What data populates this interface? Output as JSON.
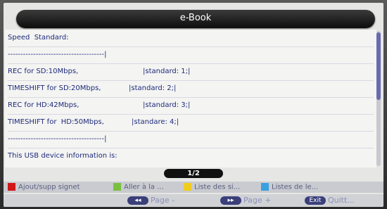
{
  "window": {
    "title": "e-Book"
  },
  "lines": [
    {
      "left": "Speed  Standard:",
      "right": ""
    },
    {
      "left": "--------------------------------------|",
      "right": ""
    },
    {
      "left": "REC for SD:10Mbps,",
      "right": "|standard: 1;|"
    },
    {
      "left": "TIMESHIFT for SD:20Mbps,",
      "right": "|standard: 2;|"
    },
    {
      "left": "REC for HD:42Mbps,",
      "right": "|standard: 3;|"
    },
    {
      "left": "TIMESHIFT for  HD:50Mbps,",
      "right": "|standare: 4;|"
    },
    {
      "left": "--------------------------------------|",
      "right": ""
    },
    {
      "left": "This USB device information is:",
      "right": ""
    }
  ],
  "pagination": {
    "label": "1/2"
  },
  "color_keys": [
    {
      "color": "#d01818",
      "label": "Ajout/supp signet"
    },
    {
      "color": "#7ac040",
      "label": "Aller à la ..."
    },
    {
      "color": "#f0cc20",
      "label": "Liste des si..."
    },
    {
      "color": "#3aa0e0",
      "label": "Listes de le..."
    }
  ],
  "nav": {
    "prev": {
      "icon": "rewind-icon",
      "button": "◂◂",
      "label": "Page -"
    },
    "next": {
      "icon": "fast-forward-icon",
      "button": "▸▸",
      "label": "Page +"
    },
    "exit": {
      "icon": "exit-icon",
      "button": "Exit",
      "label": "Quitt..."
    }
  }
}
